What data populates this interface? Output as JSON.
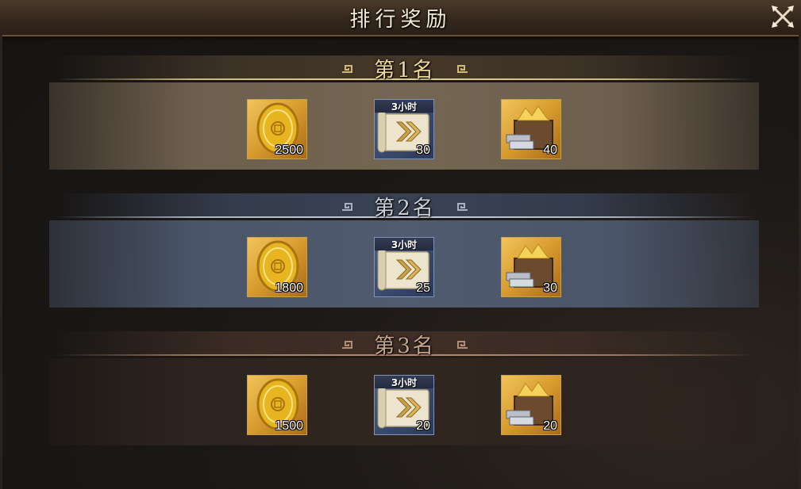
{
  "header": {
    "title": "排行奖励"
  },
  "ranks": [
    {
      "label": "第1名",
      "items": [
        {
          "icon": "gold-coin-icon",
          "count": "2500"
        },
        {
          "icon": "speedup-scroll-icon",
          "tag": "3小时",
          "count": "30"
        },
        {
          "icon": "treasure-chest-icon",
          "count": "40"
        }
      ]
    },
    {
      "label": "第2名",
      "items": [
        {
          "icon": "gold-coin-icon",
          "count": "1800"
        },
        {
          "icon": "speedup-scroll-icon",
          "tag": "3小时",
          "count": "25"
        },
        {
          "icon": "treasure-chest-icon",
          "count": "30"
        }
      ]
    },
    {
      "label": "第3名",
      "items": [
        {
          "icon": "gold-coin-icon",
          "count": "1500"
        },
        {
          "icon": "speedup-scroll-icon",
          "tag": "3小时",
          "count": "20"
        },
        {
          "icon": "treasure-chest-icon",
          "count": "20"
        }
      ]
    }
  ],
  "colors": {
    "rank1": "#f0d89a",
    "rank2": "#c9ced8",
    "rank3": "#c8a58a"
  }
}
